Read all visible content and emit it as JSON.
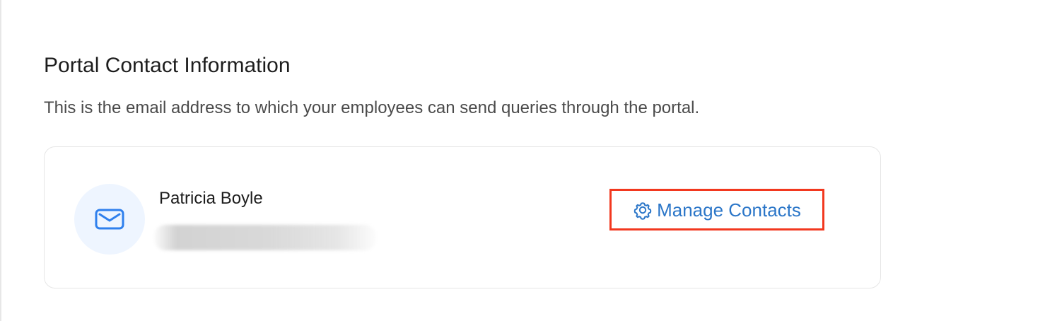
{
  "section": {
    "title": "Portal Contact Information",
    "description": "This is the email address to which your employees can send queries through the portal."
  },
  "contact": {
    "name": "Patricia Boyle",
    "email_blurred": "████████████████",
    "avatar_icon": "mail-icon"
  },
  "actions": {
    "manage_contacts_label": "Manage Contacts",
    "manage_contacts_icon": "gear-icon",
    "highlight_color": "#f2381f",
    "link_color": "#2b76c8"
  }
}
